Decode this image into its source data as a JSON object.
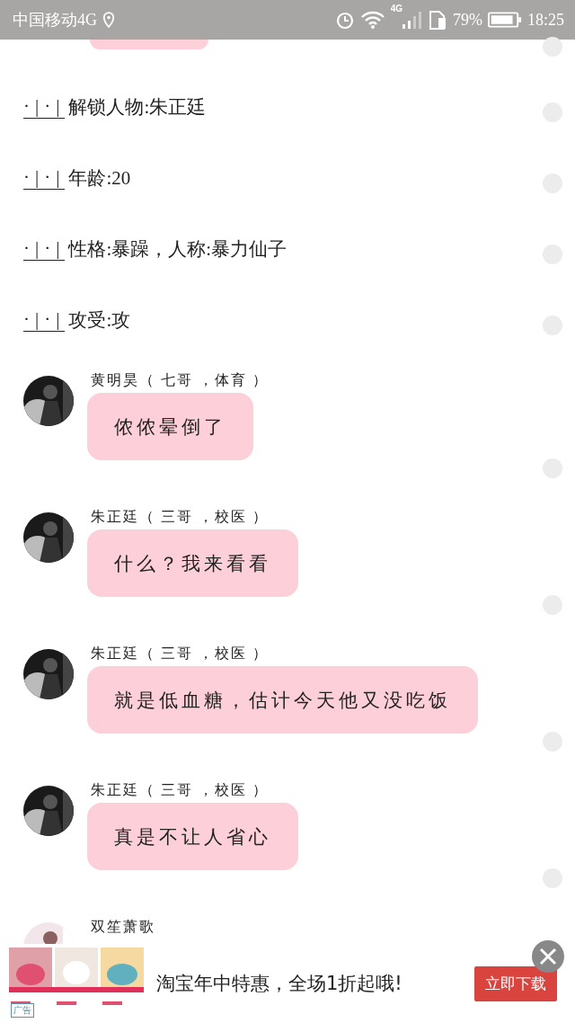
{
  "status_bar": {
    "carrier": "中国移动4G",
    "network": "4G",
    "battery": "79%",
    "time": "18:25"
  },
  "narration": [
    {
      "prefix": "·|·|",
      "text": "解锁人物:朱正廷"
    },
    {
      "prefix": "·|·|",
      "text": "年龄:20"
    },
    {
      "prefix": "·|·|",
      "text": "性格:暴躁，人称:暴力仙子"
    },
    {
      "prefix": "·|·|",
      "text": "攻受:攻"
    }
  ],
  "messages": [
    {
      "sender": "黄明昊（ 七哥 ，体育 ）",
      "text": "侬侬晕倒了"
    },
    {
      "sender": "朱正廷（ 三哥 ，校医 ）",
      "text": "什么？我来看看"
    },
    {
      "sender": "朱正廷（ 三哥 ，校医 ）",
      "text": "就是低血糖，估计今天他又没吃饭"
    },
    {
      "sender": "朱正廷（ 三哥 ，校医 ）",
      "text": "真是不让人省心"
    },
    {
      "sender": "双笙萧歌"
    }
  ],
  "ad": {
    "label": "广告",
    "headline": "淘宝年中特惠，全场1折起哦!",
    "button": "立即下载"
  }
}
